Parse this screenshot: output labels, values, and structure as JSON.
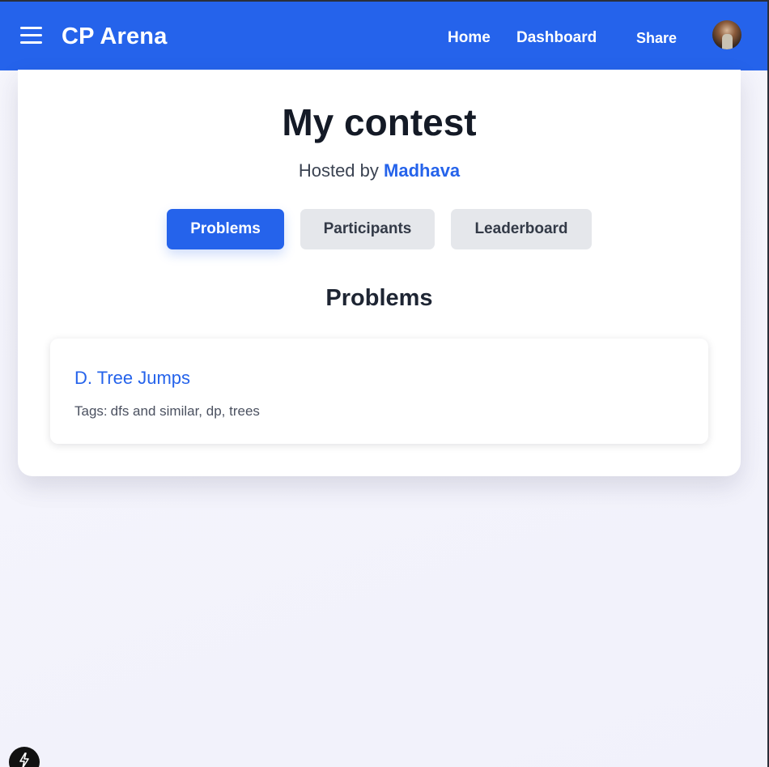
{
  "app": {
    "brand": "CP Arena",
    "nav": {
      "home": "Home",
      "dashboard": "Dashboard",
      "share": "Share"
    }
  },
  "contest": {
    "title": "My contest",
    "hosted_prefix": "Hosted by",
    "host": "Madhava",
    "tabs": [
      "Problems",
      "Participants",
      "Leaderboard"
    ],
    "active_tab": "Problems",
    "section_title": "Problems",
    "problems": [
      {
        "title": "D. Tree Jumps",
        "tags_label": "Tags:",
        "tags": "dfs and similar, dp, trees"
      }
    ]
  },
  "icons": {
    "menu": "hamburger-menu-icon",
    "avatar": "user-avatar",
    "devtools": "lightning-bolt-icon"
  },
  "colors": {
    "primary": "#2563eb",
    "tab_inactive": "#e5e7eb",
    "heading": "#141a26"
  }
}
